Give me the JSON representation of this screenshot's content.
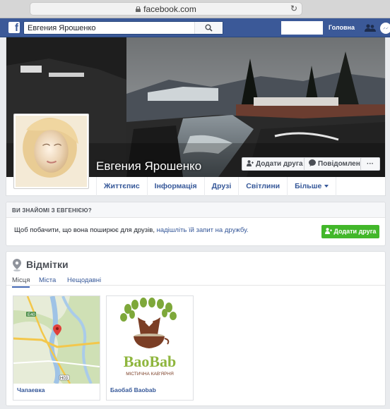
{
  "browser": {
    "url": "facebook.com"
  },
  "nav": {
    "search_value": "Евгения Ярошенко",
    "home_label": "Головна",
    "colors": {
      "brand": "#3b5998"
    }
  },
  "profile": {
    "name": "Евгения Ярошенко",
    "buttons": {
      "add_friend": "Додати друга",
      "message": "Повідомлення",
      "more": "···"
    },
    "tabs": [
      "Життєпис",
      "Інформація",
      "Друзі",
      "Світлини",
      "Більше"
    ]
  },
  "know_box": {
    "title": "ВИ ЗНАЙОМІ З ЕВГЕНІЄЮ?",
    "text_before": "Щоб побачити, що вона поширює для друзів, ",
    "link_text": "надішліть їй запит на дружбу.",
    "add_friend_label": "Додати друга",
    "accent": "#42b72a"
  },
  "checkins": {
    "title": "Відмітки",
    "tabs": [
      "Місця",
      "Міста",
      "Нещодавні"
    ],
    "active_tab": "Місця",
    "places": [
      {
        "name": "Чапаевка",
        "map_labels": [
          "E40",
          "H03"
        ]
      },
      {
        "name": "Баобаб Baobab",
        "logo_text": "BaoBab",
        "logo_sub": "МІСТИЧНА КАВ'ЯРНЯ"
      }
    ]
  }
}
